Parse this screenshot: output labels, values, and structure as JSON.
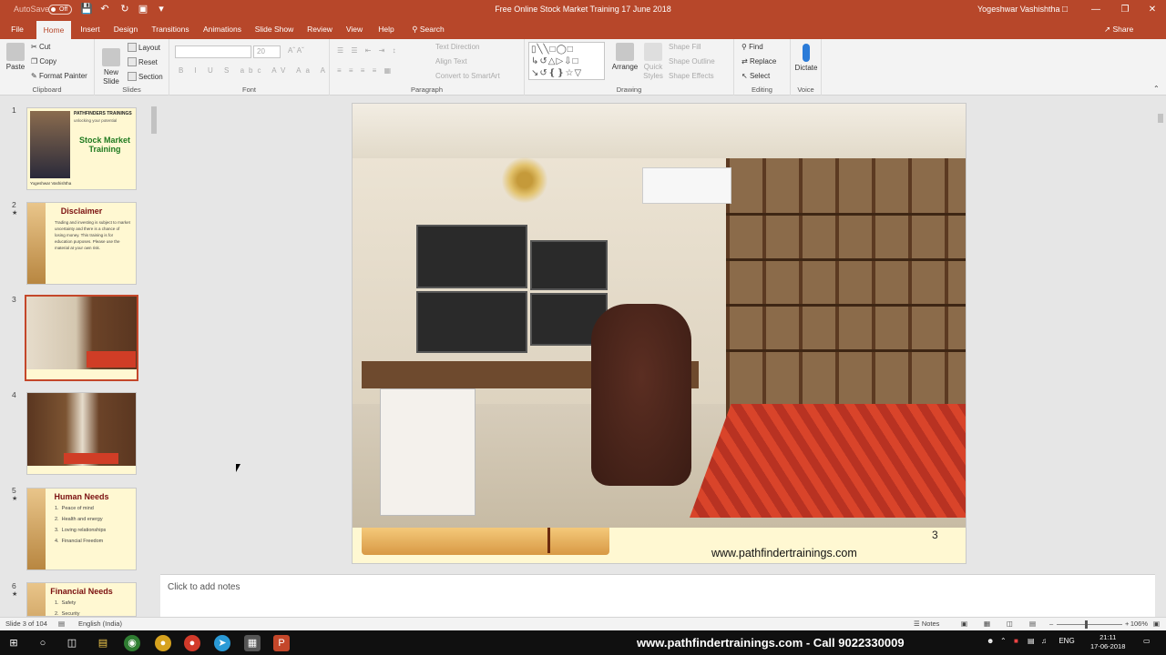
{
  "titlebar": {
    "autosave_label": "AutoSave",
    "autosave_state": "Off",
    "doc_title": "Free Online Stock Market Training 17 June 2018",
    "user_name": "Yogeshwar Vashishtha"
  },
  "tabs": [
    "File",
    "Home",
    "Insert",
    "Design",
    "Transitions",
    "Animations",
    "Slide Show",
    "Review",
    "View",
    "Help"
  ],
  "active_tab": "Home",
  "search_label": "Search",
  "share_label": "Share",
  "ribbon": {
    "clipboard": {
      "label": "Clipboard",
      "paste": "Paste",
      "cut": "Cut",
      "copy": "Copy",
      "format_painter": "Format Painter"
    },
    "slides": {
      "label": "Slides",
      "new_slide": "New Slide",
      "layout": "Layout",
      "reset": "Reset",
      "section": "Section"
    },
    "font": {
      "label": "Font",
      "size": "20"
    },
    "paragraph": {
      "label": "Paragraph",
      "text_direction": "Text Direction",
      "align_text": "Align Text",
      "convert_smartart": "Convert to SmartArt"
    },
    "drawing": {
      "label": "Drawing",
      "arrange": "Arrange",
      "quick_styles": "Quick Styles",
      "shape_fill": "Shape Fill",
      "shape_outline": "Shape Outline",
      "shape_effects": "Shape Effects"
    },
    "editing": {
      "label": "Editing",
      "find": "Find",
      "replace": "Replace",
      "select": "Select"
    },
    "voice": {
      "label": "Voice",
      "dictate": "Dictate"
    }
  },
  "thumbnails": [
    {
      "num": "1",
      "title": "Stock Market Training",
      "brand": "PATHFINDERS TRAININGS",
      "tagline": "unlocking your potential",
      "caption": "Yogeshwar Vashishtha"
    },
    {
      "num": "2",
      "title": "Disclaimer",
      "text": "Trading and investing is subject to market uncertainty and there is a chance of losing money. This training is for education purposes. Please use the material at your own risk."
    },
    {
      "num": "3"
    },
    {
      "num": "4"
    },
    {
      "num": "5",
      "title": "Human Needs",
      "items": [
        "Peace of mind",
        "Health and energy",
        "Loving relationships",
        "Financial Freedom"
      ]
    },
    {
      "num": "6",
      "title": "Financial Needs",
      "items": [
        "Safety",
        "Security"
      ]
    }
  ],
  "slide": {
    "page_number": "3",
    "url": "www.pathfindertrainings.com"
  },
  "notes_placeholder": "Click to add notes",
  "status": {
    "slide_count": "Slide 3 of 104",
    "language": "English (India)",
    "notes": "Notes",
    "zoom": "106%"
  },
  "taskbar": {
    "banner": "www.pathfindertrainings.com - Call 9022330009",
    "lang": "ENG",
    "time": "21:11",
    "date": "17-06-2018"
  }
}
